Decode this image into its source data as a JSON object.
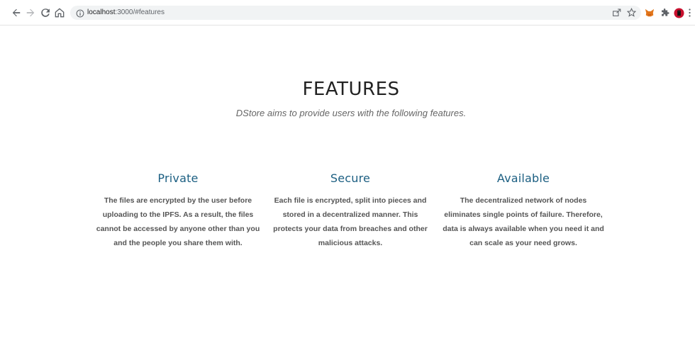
{
  "browser": {
    "url_host": "localhost",
    "url_path": ":3000/#features"
  },
  "icons": {
    "back": "arrow-left-icon",
    "forward": "arrow-right-icon",
    "reload": "reload-icon",
    "home": "home-icon",
    "site_info": "info-icon",
    "share": "share-icon",
    "bookmark": "star-icon",
    "metamask": "fox-icon",
    "extensions": "puzzle-icon",
    "profile": "avatar-icon",
    "menu": "more-vertical-icon"
  },
  "section": {
    "title": "FEATURES",
    "subtitle": "DStore aims to provide users with the following features."
  },
  "features": [
    {
      "title": "Private",
      "description": "The files are encrypted by the user before uploading to the IPFS. As a result, the files cannot be accessed by anyone other than you and the people you share them with."
    },
    {
      "title": "Secure",
      "description": "Each file is encrypted, split into pieces and stored in a decentralized manner. This protects your data from breaches and other malicious attacks."
    },
    {
      "title": "Available",
      "description": "The decentralized network of nodes eliminates single points of failure. Therefore, data is always available when you need it and can scale as your need grows."
    }
  ],
  "colors": {
    "feature_title": "#1c5f82",
    "omnibox_bg": "#f1f3f4",
    "metamask": "#e2761b",
    "profile_bg": "#c8102e"
  }
}
